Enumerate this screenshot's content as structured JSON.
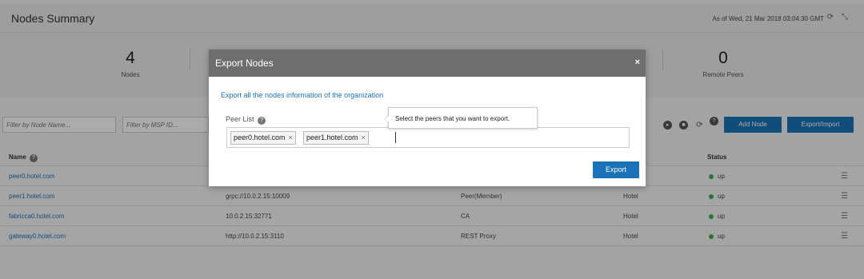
{
  "header": {
    "title": "Nodes Summary",
    "as_of": "As of Wed, 21 Mar 2018 03:04:30 GMT",
    "refresh_icon": "refresh-icon",
    "collapse_icon": "collapse-icon"
  },
  "summary": {
    "stats": [
      {
        "value": "4",
        "label": "Nodes"
      },
      {
        "value": "0",
        "label": "Remote Peers"
      }
    ]
  },
  "toolbar": {
    "filter_name_placeholder": "Filter by Node Name...",
    "filter_msp_placeholder": "Filter by MSP ID...",
    "add_node_label": "Add Node",
    "export_import_label": "Export/Import"
  },
  "table": {
    "headers": {
      "name": "Name",
      "status": "Status"
    },
    "rows": [
      {
        "name": "peer0.hotel.com",
        "url": "",
        "type": "",
        "msp": "",
        "status": "up"
      },
      {
        "name": "peer1.hotel.com",
        "url": "grpc://10.0.2.15:10009",
        "type": "Peer(Member)",
        "msp": "Hotel",
        "status": "up"
      },
      {
        "name": "fabricca0.hotel.com",
        "url": "10.0.2.15:32771",
        "type": "CA",
        "msp": "Hotel",
        "status": "up"
      },
      {
        "name": "gateway0.hotel.com",
        "url": "http://10.0.2.15:3110",
        "type": "REST Proxy",
        "msp": "Hotel",
        "status": "up"
      }
    ],
    "status_color": "#3fae49"
  },
  "modal": {
    "title": "Export Nodes",
    "close": "×",
    "description": "Export all the nodes information of the organization",
    "peer_list_label": "Peer List",
    "help": "?",
    "tags": [
      "peer0.hotel.com",
      "peer1.hotel.com"
    ],
    "tag_remove": "×",
    "tooltip": "Select the peers that you want to export.",
    "export_label": "Export"
  },
  "colors": {
    "accent": "#1a73b8",
    "modal_header": "#6e6e6e"
  }
}
